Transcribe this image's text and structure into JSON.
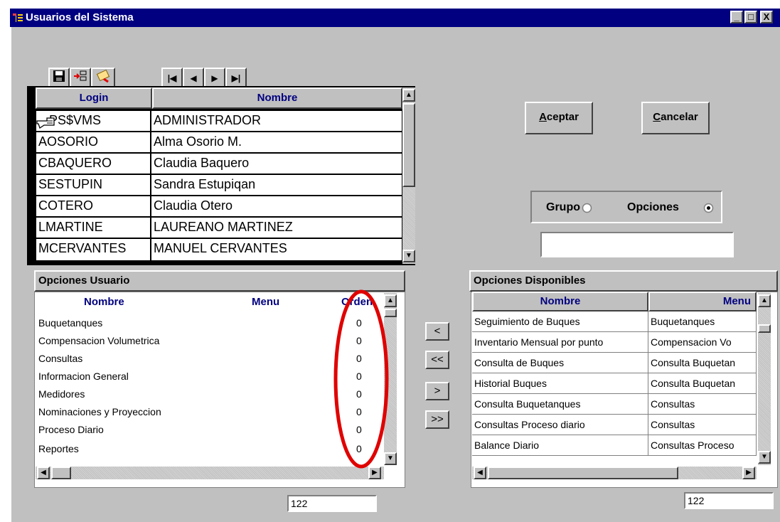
{
  "window": {
    "title": "Usuarios del Sistema",
    "controls": [
      "_",
      "□",
      "X"
    ]
  },
  "toolbar": {
    "icons": [
      "save-icon",
      "insert-record-icon",
      "delete-record-icon"
    ],
    "nav": [
      "|◀",
      "◀",
      "▶",
      "▶|"
    ]
  },
  "users_grid": {
    "columns": [
      "Login",
      "Nombre"
    ],
    "rows": [
      {
        "login": "PS$VMS",
        "nombre": "ADMINISTRADOR"
      },
      {
        "login": "AOSORIO",
        "nombre": "Alma Osorio M."
      },
      {
        "login": "CBAQUERO",
        "nombre": "Claudia Baquero"
      },
      {
        "login": "SESTUPIN",
        "nombre": "Sandra Estupiqan"
      },
      {
        "login": "COTERO",
        "nombre": "Claudia Otero"
      },
      {
        "login": "LMARTINE",
        "nombre": "LAUREANO MARTINEZ"
      },
      {
        "login": "MCERVANTES",
        "nombre": "MANUEL CERVANTES"
      }
    ]
  },
  "actions": {
    "accept_label": "Aceptar",
    "accept_mnemonic": "A",
    "accept_rest": "ceptar",
    "cancel_label": "Cancelar",
    "cancel_mnemonic": "C",
    "cancel_rest": "ancelar"
  },
  "mode": {
    "grupo_label": "Grupo",
    "opciones_label": "Opciones",
    "selected": "Opciones",
    "field_value": ""
  },
  "user_options": {
    "title": "Opciones Usuario",
    "columns": [
      "Nombre",
      "Menu",
      "Orden"
    ],
    "rows": [
      {
        "nombre": "Buquetanques",
        "menu": "",
        "orden": "0"
      },
      {
        "nombre": "Compensacion Volumetrica",
        "menu": "",
        "orden": "0"
      },
      {
        "nombre": "Consultas",
        "menu": "",
        "orden": "0"
      },
      {
        "nombre": "Informacion General",
        "menu": "",
        "orden": "0"
      },
      {
        "nombre": "Medidores",
        "menu": "",
        "orden": "0"
      },
      {
        "nombre": "Nominaciones y Proyeccion",
        "menu": "",
        "orden": "0"
      },
      {
        "nombre": "Proceso Diario",
        "menu": "",
        "orden": "0"
      },
      {
        "nombre": "Reportes",
        "menu": "",
        "orden": "0"
      }
    ],
    "counter": "122"
  },
  "move_buttons": [
    "<",
    "<<",
    ">",
    ">>"
  ],
  "available_options": {
    "title": "Opciones Disponibles",
    "columns": [
      "Nombre",
      "Menu"
    ],
    "rows": [
      {
        "nombre": "Seguimiento de Buques",
        "menu": "Buquetanques"
      },
      {
        "nombre": "Inventario Mensual por punto",
        "menu": "Compensacion Vo"
      },
      {
        "nombre": "Consulta de Buques",
        "menu": "Consulta Buquetan"
      },
      {
        "nombre": "Historial Buques",
        "menu": "Consulta Buquetan"
      },
      {
        "nombre": "Consulta Buquetanques",
        "menu": "Consultas"
      },
      {
        "nombre": "Consultas Proceso diario",
        "menu": "Consultas"
      },
      {
        "nombre": "Balance Diario",
        "menu": "Consultas Proceso"
      }
    ],
    "counter": "122"
  },
  "colors": {
    "titlebar": "#000080",
    "face": "#c0c0c0",
    "header_text": "#000080",
    "annotation": "#e00000"
  }
}
